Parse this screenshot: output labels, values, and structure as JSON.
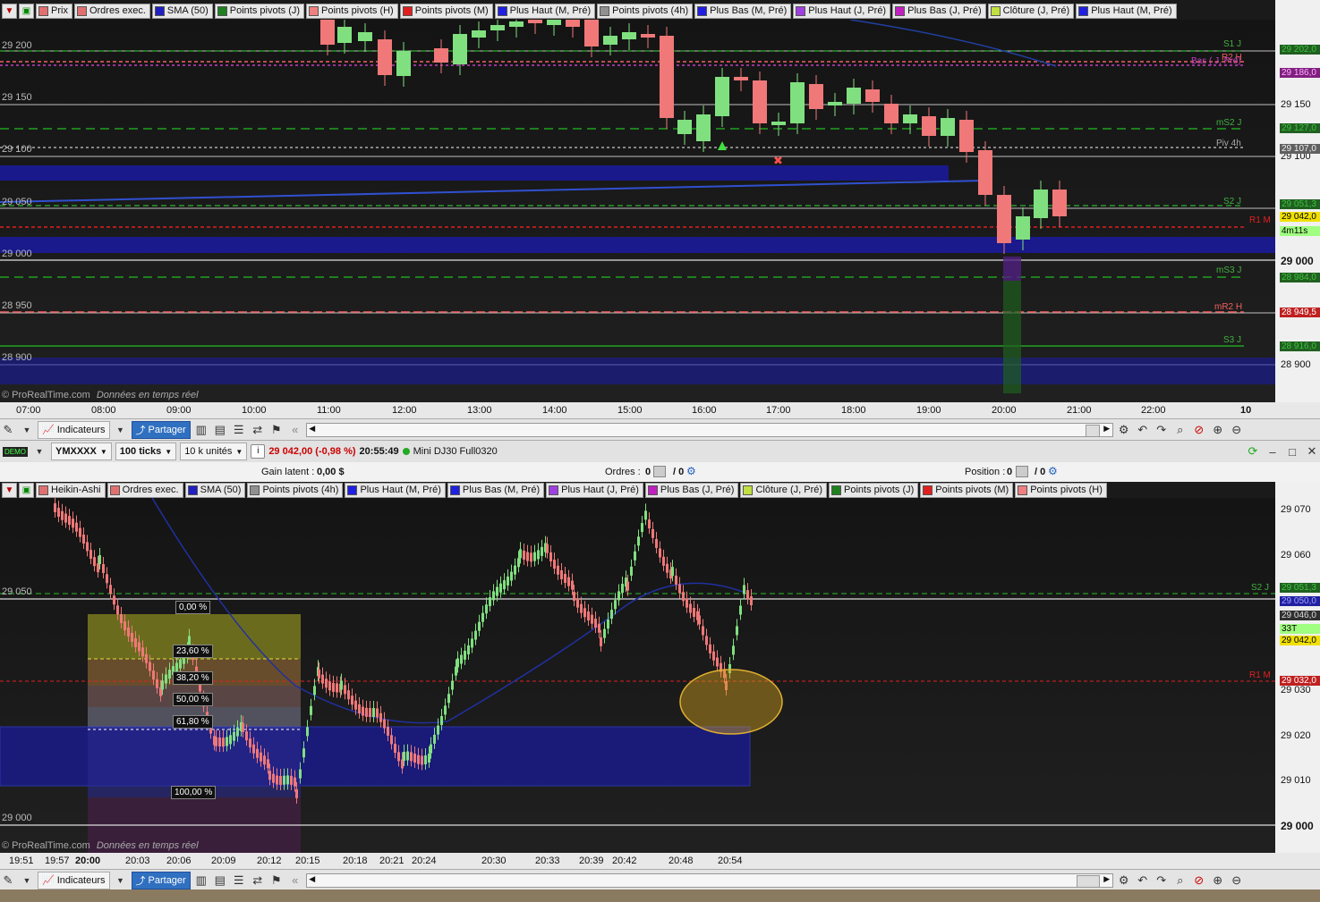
{
  "top_chart": {
    "legend": [
      {
        "label": "Prix",
        "color": "#e07070"
      },
      {
        "label": "Ordres exec.",
        "color": "#e07070"
      },
      {
        "label": "SMA (50)",
        "color": "#2020c0"
      },
      {
        "label": "Points pivots (J)",
        "color": "#208020"
      },
      {
        "label": "Points pivots (H)",
        "color": "#f08080"
      },
      {
        "label": "Points pivots (M)",
        "color": "#e02020"
      },
      {
        "label": "Plus Haut (M, Pré)",
        "color": "#2020e0"
      },
      {
        "label": "Points pivots (4h)",
        "color": "#909090"
      },
      {
        "label": "Plus Bas (M, Pré)",
        "color": "#2020e0"
      },
      {
        "label": "Plus Haut (J, Pré)",
        "color": "#a040e0"
      },
      {
        "label": "Plus Bas (J, Pré)",
        "color": "#c020c0"
      },
      {
        "label": "Clôture (J, Pré)",
        "color": "#c0e040"
      },
      {
        "label": "Plus Haut (M, Pré)",
        "color": "#2020e0"
      }
    ],
    "y_labels_left": [
      "29 200",
      "29 150",
      "29 100",
      "29 050",
      "29 000",
      "28 950",
      "28 900"
    ],
    "y_labels_right": [
      "29 150",
      "29 100",
      "29 000",
      "28 900"
    ],
    "right_tags": [
      {
        "text": "29 202,0",
        "bg": "#206020",
        "color": "#40c040"
      },
      {
        "text": "29 186,0",
        "bg": "#802080",
        "color": "#ffb0ff"
      },
      {
        "text": "29 127,0",
        "bg": "#206020",
        "color": "#40c040"
      },
      {
        "text": "29 107,0",
        "bg": "#606060",
        "color": "#eee"
      },
      {
        "text": "29 051,3",
        "bg": "#206020",
        "color": "#40c040"
      },
      {
        "text": "29 042,0",
        "bg": "#f0e000",
        "color": "#000"
      },
      {
        "text": "4m11s",
        "bg": "#a0ff80",
        "color": "#000"
      },
      {
        "text": "28 984,0",
        "bg": "#206020",
        "color": "#40c040"
      },
      {
        "text": "28 949,5",
        "bg": "#c02020",
        "color": "#fff"
      },
      {
        "text": "28 916,0",
        "bg": "#206020",
        "color": "#40c040"
      }
    ],
    "level_labels": [
      {
        "text": "S1 J",
        "color": "#40b040"
      },
      {
        "text": "R2 H",
        "color": "#f06060"
      },
      {
        "text": "Bas ( J, Pré)",
        "color": "#c040c0"
      },
      {
        "text": "mS2 J",
        "color": "#40b040"
      },
      {
        "text": "Piv 4h",
        "color": "#aaa"
      },
      {
        "text": "S2 J",
        "color": "#40b040"
      },
      {
        "text": "R1 M",
        "color": "#e02020"
      },
      {
        "text": "mS3 J",
        "color": "#40b040"
      },
      {
        "text": "mR2 H",
        "color": "#f06060"
      },
      {
        "text": "S3 J",
        "color": "#40b040"
      }
    ],
    "x_labels": [
      "07:00",
      "08:00",
      "09:00",
      "10:00",
      "11:00",
      "12:00",
      "13:00",
      "14:00",
      "15:00",
      "16:00",
      "17:00",
      "18:00",
      "19:00",
      "20:00",
      "21:00",
      "22:00",
      "10"
    ],
    "watermark": "© ProRealTime.com",
    "watermark_italic": "Données en temps réel"
  },
  "toolbar": {
    "indicators_label": "Indicateurs",
    "share_label": "Partager"
  },
  "instrument_bar": {
    "demo": "DEMO",
    "symbol": "YMXXXX",
    "interval": "100 ticks",
    "units": "10 k unités",
    "price": "29 042,00 (-0,98 %)",
    "time": "20:55:49",
    "name": "Mini DJ30 Full0320"
  },
  "info_bar": {
    "gain_label": "Gain latent :",
    "gain_value": "0,00 $",
    "orders_label": "Ordres :",
    "orders_value": "0",
    "orders_value2": "/ 0",
    "position_label": "Position :",
    "position_value": "0",
    "position_value2": "/ 0"
  },
  "bottom_chart": {
    "legend": [
      {
        "label": "Heikin-Ashi",
        "color": "#e07070"
      },
      {
        "label": "Ordres exec.",
        "color": "#e07070"
      },
      {
        "label": "SMA (50)",
        "color": "#2020c0"
      },
      {
        "label": "Points pivots (4h)",
        "color": "#909090"
      },
      {
        "label": "Plus Haut (M, Pré)",
        "color": "#2020e0"
      },
      {
        "label": "Plus Bas (M, Pré)",
        "color": "#2020e0"
      },
      {
        "label": "Plus Haut (J, Pré)",
        "color": "#a040e0"
      },
      {
        "label": "Plus Bas (J, Pré)",
        "color": "#c020c0"
      },
      {
        "label": "Clôture (J, Pré)",
        "color": "#c0e040"
      },
      {
        "label": "Points pivots (J)",
        "color": "#208020"
      },
      {
        "label": "Points pivots (M)",
        "color": "#e02020"
      },
      {
        "label": "Points pivots (H)",
        "color": "#f08080"
      }
    ],
    "y_labels_left": [
      "29 050",
      "29 000"
    ],
    "y_labels_right": [
      "29 070",
      "29 060",
      "29 030",
      "29 020",
      "29 010",
      "29 000"
    ],
    "right_tags": [
      {
        "text": "29 051,3",
        "bg": "#206020",
        "color": "#40c040"
      },
      {
        "text": "29 050,0",
        "bg": "#2020a0",
        "color": "#a0a0ff"
      },
      {
        "text": "29 046,0",
        "bg": "#303030",
        "color": "#ddd"
      },
      {
        "text": "33T",
        "bg": "#a0ff80",
        "color": "#000"
      },
      {
        "text": "29 042,0",
        "bg": "#f0e000",
        "color": "#000"
      },
      {
        "text": "29 032,0",
        "bg": "#c02020",
        "color": "#fff"
      }
    ],
    "level_labels": [
      {
        "text": "S2 J",
        "color": "#40b040"
      },
      {
        "text": "R1 M",
        "color": "#e02020"
      }
    ],
    "fib_labels": [
      "0,00 %",
      "23,60 %",
      "38,20 %",
      "50,00 %",
      "61,80 %",
      "100,00 %"
    ],
    "x_labels": [
      "19:51",
      "19:57",
      "20:00",
      "20:03",
      "20:06",
      "20:09",
      "20:12",
      "20:15",
      "20:18",
      "20:21",
      "20:24",
      "20:30",
      "20:33",
      "20:39",
      "20:42",
      "20:48",
      "20:54"
    ],
    "watermark": "© ProRealTime.com",
    "watermark_italic": "Données en temps réel"
  }
}
